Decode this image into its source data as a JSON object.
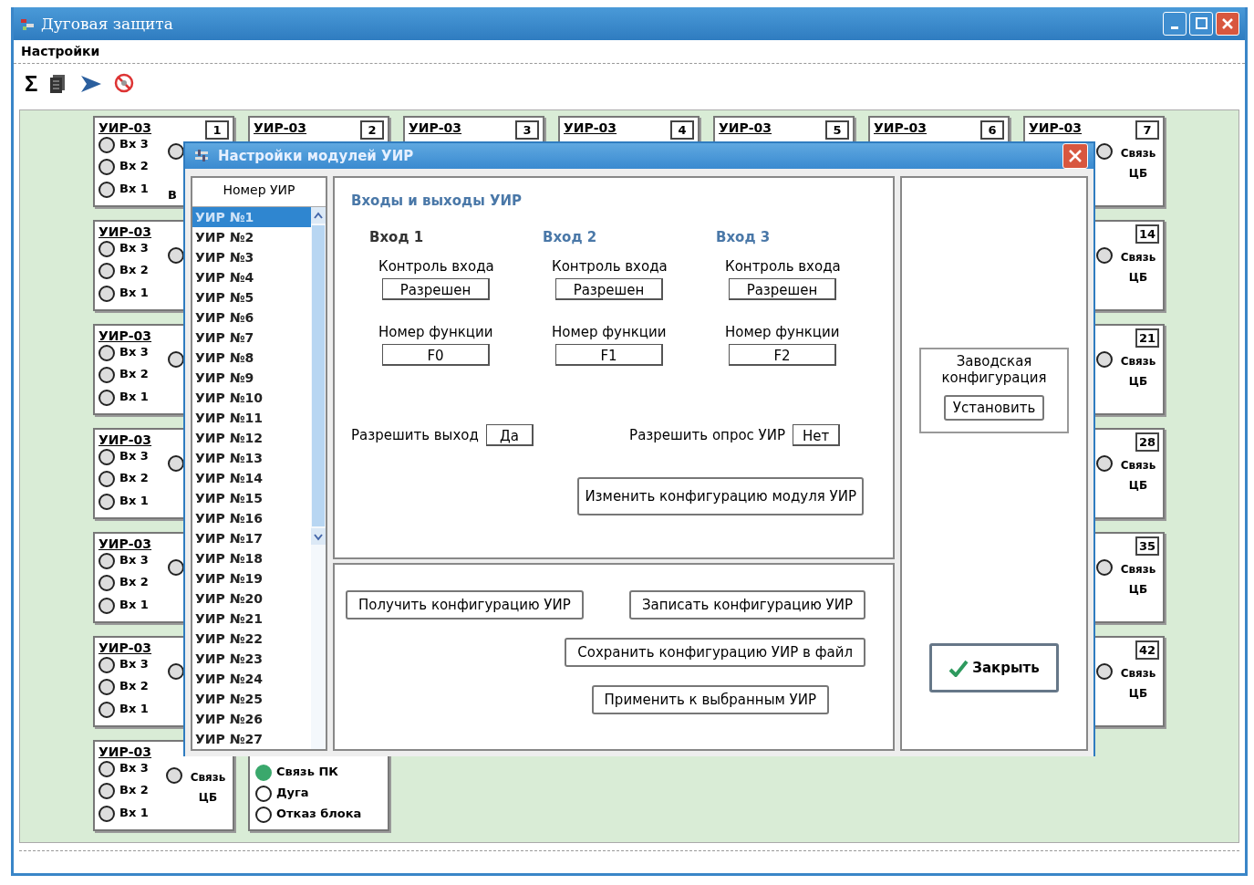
{
  "window": {
    "title": "Дуговая защита"
  },
  "menu": [
    {
      "label": "Настройки"
    }
  ],
  "toolbar": [
    {
      "kind": "glyph",
      "label": "Σ"
    },
    {
      "kind": "document"
    },
    {
      "kind": "arrow"
    },
    {
      "kind": "stop"
    }
  ],
  "left_column": [
    {
      "title": "УИР-03",
      "number": "1",
      "inputs": [
        "Вх 3",
        "Вх 2",
        "Вх 1"
      ],
      "output": "В"
    },
    {
      "title": "УИР-03",
      "inputs": [
        "Вх 3",
        "Вх 2",
        "Вх 1"
      ]
    },
    {
      "title": "УИР-03",
      "inputs": [
        "Вх 3",
        "Вх 2",
        "Вх 1"
      ]
    },
    {
      "title": "УИР-03",
      "inputs": [
        "Вх 3",
        "Вх 2",
        "Вх 1"
      ]
    },
    {
      "title": "УИР-03",
      "inputs": [
        "Вх 3",
        "Вх 2",
        "Вх 1"
      ]
    },
    {
      "title": "УИР-03",
      "inputs": [
        "Вх 3",
        "Вх 2",
        "Вх 1"
      ]
    },
    {
      "title": "УИР-03",
      "inputs": [
        "Вх 3",
        "Вх 2",
        "Вх 1"
      ],
      "link": "Связь ЦБ"
    }
  ],
  "top_row": [
    {
      "title": "УИР-03",
      "number": "2"
    },
    {
      "title": "УИР-03",
      "number": "3"
    },
    {
      "title": "УИР-03",
      "number": "4"
    },
    {
      "title": "УИР-03",
      "number": "5"
    },
    {
      "title": "УИР-03",
      "number": "6"
    }
  ],
  "right_column": [
    {
      "title": "УИР-03",
      "number": "7",
      "link": "Связь ЦБ"
    },
    {
      "number": "14",
      "link": "Связь ЦБ"
    },
    {
      "number": "21",
      "link": "Связь ЦБ"
    },
    {
      "number": "28",
      "link": "Связь ЦБ"
    },
    {
      "number": "35",
      "link": "Связь ЦБ"
    },
    {
      "number": "42",
      "link": "Связь ЦБ"
    }
  ],
  "status_panel": {
    "items": [
      {
        "label": "Связь ПК",
        "on": true
      },
      {
        "label": "Дуга",
        "on": false
      },
      {
        "label": "Отказ блока",
        "on": false
      }
    ]
  },
  "dialog": {
    "title": "Настройки модулей УИР",
    "list": {
      "header": "Номер УИР",
      "items": [
        {
          "label": "УИР №1",
          "selected": true
        },
        {
          "label": "УИР №2",
          "selected": false
        },
        {
          "label": "УИР №3",
          "selected": false
        },
        {
          "label": "УИР №4",
          "selected": false
        },
        {
          "label": "УИР №5",
          "selected": false
        },
        {
          "label": "УИР №6",
          "selected": false
        },
        {
          "label": "УИР №7",
          "selected": false
        },
        {
          "label": "УИР №8",
          "selected": false
        },
        {
          "label": "УИР №9",
          "selected": false
        },
        {
          "label": "УИР №10",
          "selected": false
        },
        {
          "label": "УИР №11",
          "selected": false
        },
        {
          "label": "УИР №12",
          "selected": false
        },
        {
          "label": "УИР №13",
          "selected": false
        },
        {
          "label": "УИР №14",
          "selected": false
        },
        {
          "label": "УИР №15",
          "selected": false
        },
        {
          "label": "УИР №16",
          "selected": false
        },
        {
          "label": "УИР №17",
          "selected": false
        },
        {
          "label": "УИР №18",
          "selected": false
        },
        {
          "label": "УИР №19",
          "selected": false
        },
        {
          "label": "УИР №20",
          "selected": false
        },
        {
          "label": "УИР №21",
          "selected": false
        },
        {
          "label": "УИР №22",
          "selected": false
        },
        {
          "label": "УИР №23",
          "selected": false
        },
        {
          "label": "УИР №24",
          "selected": false
        },
        {
          "label": "УИР №25",
          "selected": false
        },
        {
          "label": "УИР №26",
          "selected": false
        },
        {
          "label": "УИР №27",
          "selected": false
        }
      ]
    },
    "section_title": "Входы и выходы УИР",
    "inputs": [
      {
        "label": "Вход 1",
        "control_label": "Контроль входа",
        "control_value": "Разрешен",
        "function_label": "Номер функции",
        "function_value": "F0"
      },
      {
        "label": "Вход 2",
        "control_label": "Контроль входа",
        "control_value": "Разрешен",
        "function_label": "Номер функции",
        "function_value": "F1"
      },
      {
        "label": "Вход 3",
        "control_label": "Контроль входа",
        "control_value": "Разрешен",
        "function_label": "Номер функции",
        "function_value": "F2"
      }
    ],
    "options": [
      {
        "label": "Разрешить выход",
        "value": "Да"
      },
      {
        "label": "Разрешить опрос УИР",
        "value": "Нет"
      }
    ],
    "change_button": "Изменить конфигурацию модуля УИР",
    "actions": [
      [
        "Получить конфигурацию УИР",
        "Записать конфигурацию УИР"
      ],
      [
        "Сохранить конфигурацию УИР в файл"
      ],
      [
        "Применить к выбранным УИР"
      ]
    ],
    "factory": {
      "label": "Заводская конфигурация",
      "button": "Установить"
    },
    "close_button": "Закрыть"
  }
}
